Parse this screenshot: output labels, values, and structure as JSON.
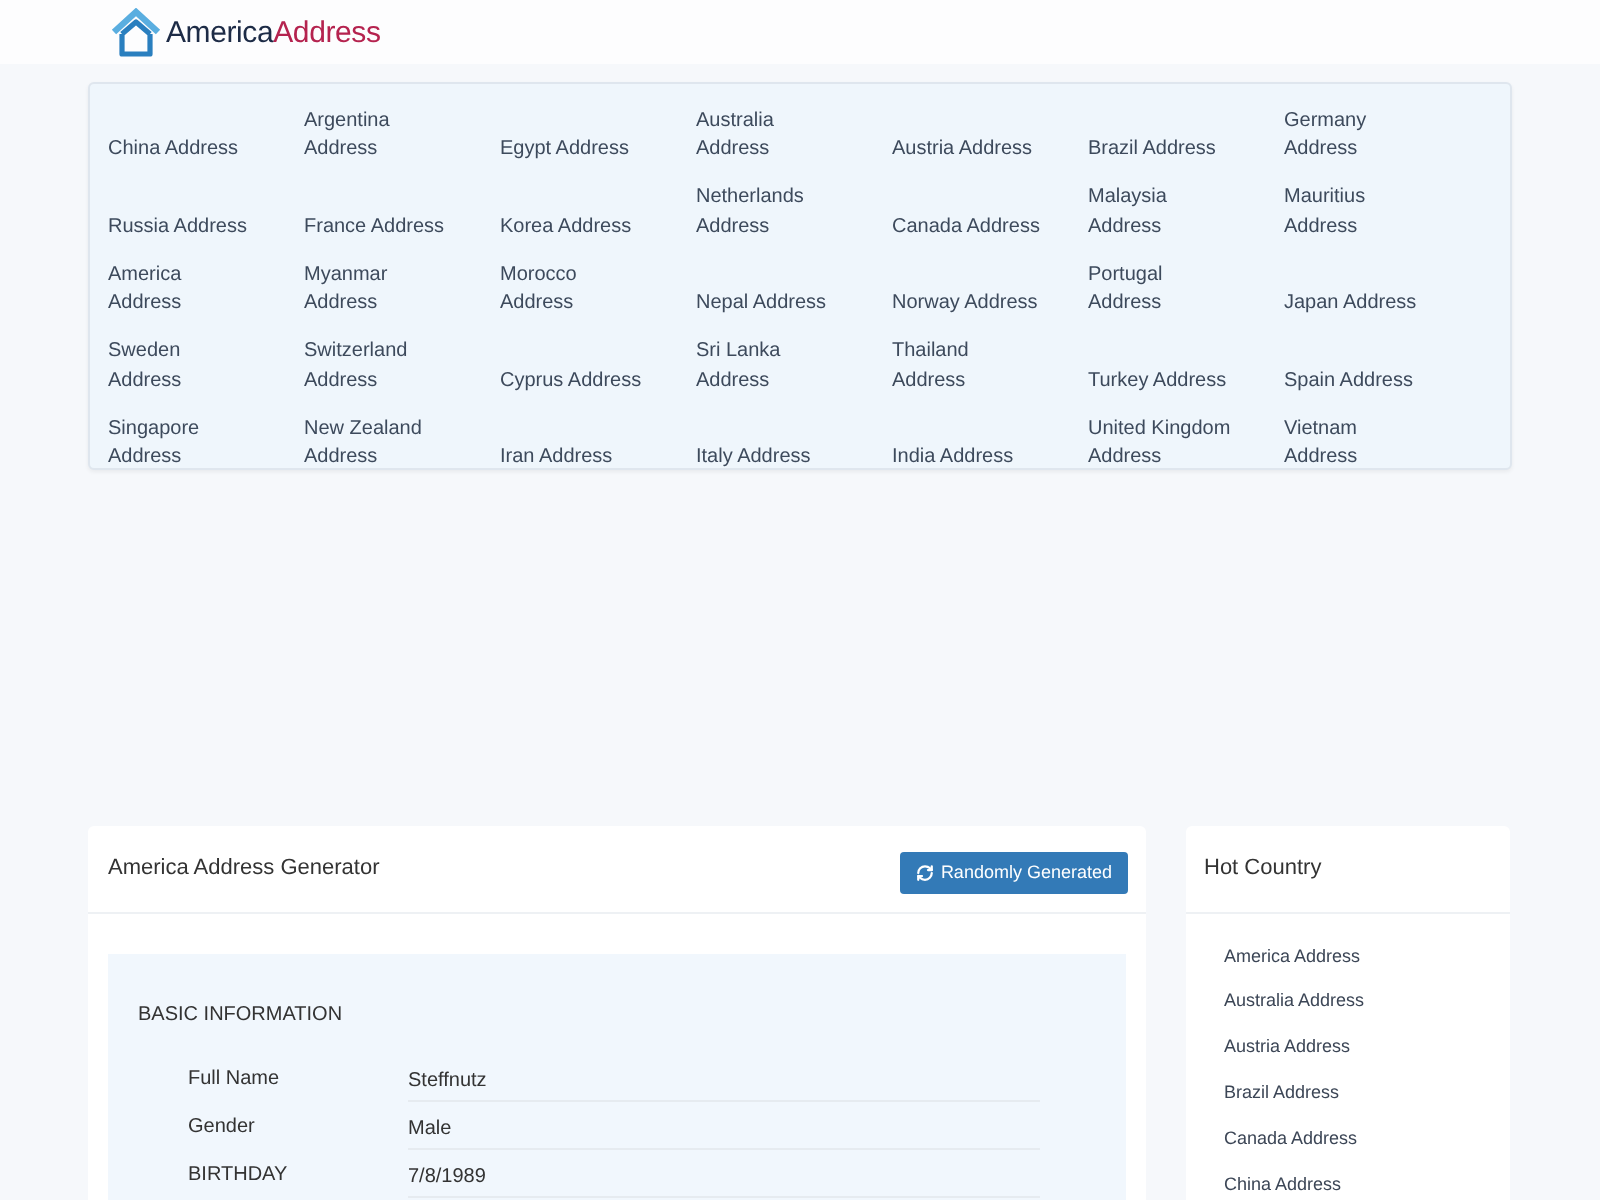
{
  "header": {
    "logo": {
      "text_1": "America",
      "text_2": "Address"
    }
  },
  "country_links": [
    "China Address",
    "Argentina Address",
    "Egypt Address",
    "Australia Address",
    "Austria Address",
    "Brazil Address",
    "Germany Address",
    "Russia Address",
    "France Address",
    "Korea Address",
    "Netherlands Address",
    "Canada Address",
    "Malaysia Address",
    "Mauritius Address",
    "America Address",
    "Myanmar Address",
    "Morocco Address",
    "Nepal Address",
    "Norway Address",
    "Portugal Address",
    "Japan Address",
    "Sweden Address",
    "Switzerland Address",
    "Cyprus Address",
    "Sri Lanka Address",
    "Thailand Address",
    "Turkey Address",
    "Spain Address",
    "Singapore Address",
    "New Zealand Address",
    "Iran Address",
    "Italy Address",
    "India Address",
    "United Kingdom Address",
    "Vietnam Address"
  ],
  "generator": {
    "title": "America Address Generator",
    "button": "Randomly Generated",
    "section_title": "BASIC INFORMATION",
    "fields": [
      {
        "label": "Full Name",
        "value": "Steffnutz"
      },
      {
        "label": "Gender",
        "value": "Male"
      },
      {
        "label": "BIRTHDAY",
        "value": "7/8/1989"
      }
    ]
  },
  "hot_country": {
    "title": "Hot Country",
    "links": [
      "America Address",
      "Australia Address",
      "Austria Address",
      "Brazil Address",
      "Canada Address",
      "China Address"
    ]
  }
}
